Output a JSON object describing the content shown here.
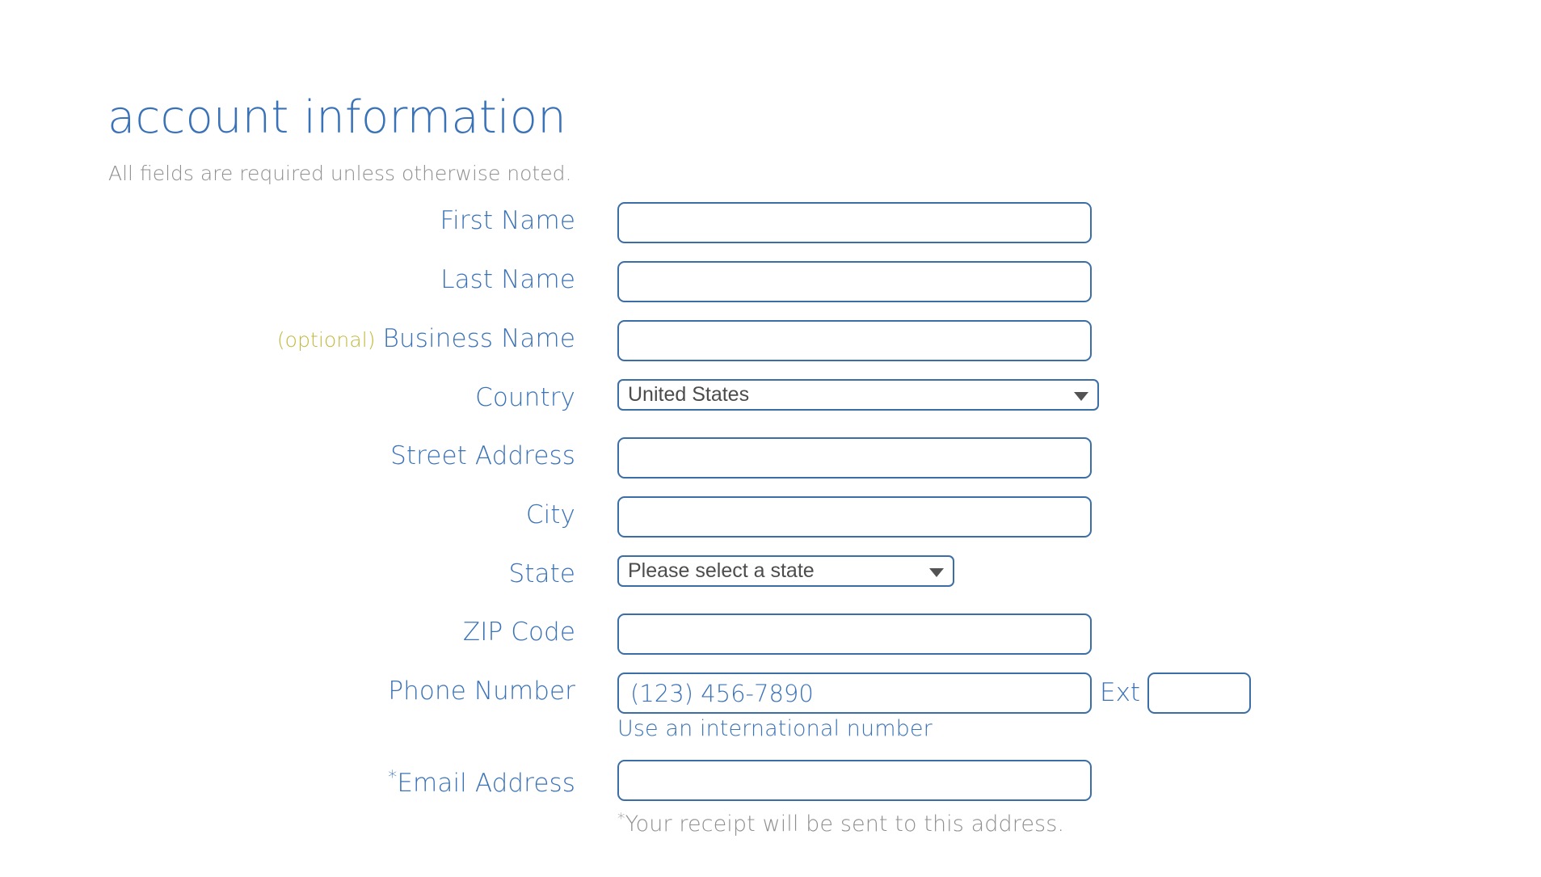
{
  "header": {
    "title": "account information",
    "subtitle": "All fields are required unless otherwise noted."
  },
  "form": {
    "first_name": {
      "label": "First Name",
      "value": "",
      "placeholder": ""
    },
    "last_name": {
      "label": "Last Name",
      "value": "",
      "placeholder": ""
    },
    "business_name": {
      "optional_tag": "(optional)",
      "label": "Business Name",
      "value": "",
      "placeholder": ""
    },
    "country": {
      "label": "Country",
      "selected": "United States",
      "options": [
        "United States"
      ],
      "arrow_icon": "chevron-down-icon"
    },
    "street_address": {
      "label": "Street Address",
      "value": "",
      "placeholder": ""
    },
    "city": {
      "label": "City",
      "value": "",
      "placeholder": ""
    },
    "state": {
      "label": "State",
      "selected": "Please select a state",
      "options": [
        "Please select a state"
      ],
      "arrow_icon": "chevron-down-icon"
    },
    "zip_code": {
      "label": "ZIP Code",
      "value": "",
      "placeholder": ""
    },
    "phone_number": {
      "label": "Phone Number",
      "value": "",
      "placeholder": "(123) 456-7890",
      "ext_label": "Ext",
      "ext_value": "",
      "ext_placeholder": "",
      "helper_link": "Use an international number"
    },
    "email_address": {
      "label_star": "*",
      "label": "Email Address",
      "value": "",
      "placeholder": "",
      "helper_note_star": "*",
      "helper_note": "Your receipt will be sent to this address."
    }
  },
  "colors": {
    "accent_blue": "#3a72b8",
    "border_blue": "#3a6ea5",
    "optional_yellow": "#c3b83c",
    "muted_gray": "#8f8f8f",
    "select_text": "#4c4c4c"
  }
}
